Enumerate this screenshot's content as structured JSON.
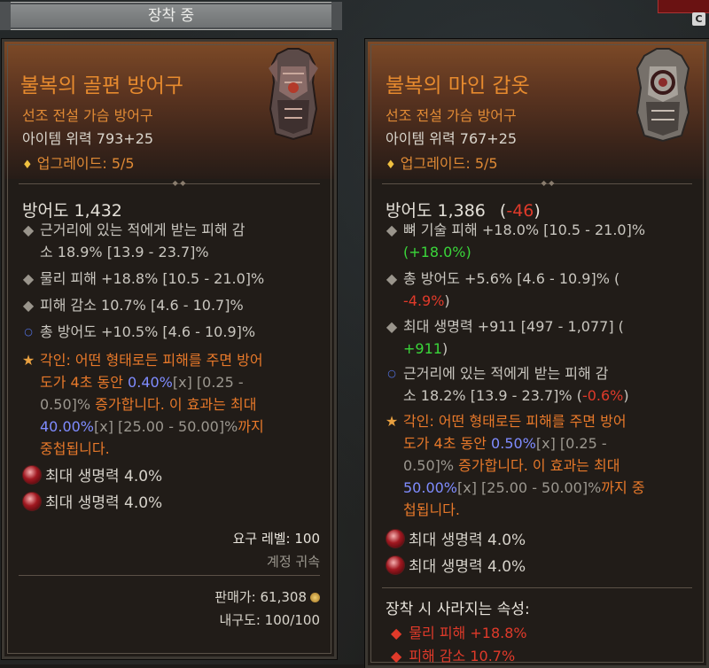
{
  "equip_tab": {
    "label": "장착 중"
  },
  "left_item": {
    "name": "불복의 골편 방어구",
    "type": "선조 전설 가슴 방어구",
    "power": "아이템 위력 793+25",
    "upgrade": "업그레이드: 5/5",
    "armor": "방어도 1,432",
    "affixes": [
      {
        "line1": "근거리에 있는 적에게 받는 피해 감",
        "line2": "소 18.9% [13.9 - 23.7]%"
      },
      {
        "text": "물리 피해 +18.8% [10.5 - 21.0]%"
      },
      {
        "text": "피해 감소 10.7% [4.6 - 10.7]%"
      },
      {
        "text": "총 방어도 +10.5% [4.6 - 10.9]%"
      }
    ],
    "aspect": {
      "l1_prefix": "각인: ",
      "l1_orange": "어떤 형태로든 피해를 주면 방어",
      "l2_orange": "도가 4초 동안 ",
      "l2_blue": "0.40%",
      "l2_gray": "[x] [0.25 -",
      "l3_gray": "0.50]%",
      "l3_orange": " 증가합니다. 이 효과는 최대",
      "l4_blue": "40.00%",
      "l4_gray": "[x] [25.00 - 50.00]%",
      "l4_orange": "까지",
      "l5_orange": "중첩됩니다."
    },
    "gems": [
      "최대 생명력 4.0%",
      "최대 생명력 4.0%"
    ],
    "required_level": "요구 레벨: 100",
    "account_bound": "계정 귀속",
    "sell_price": "판매가: 61,308",
    "durability": "내구도: 100/100"
  },
  "right_item": {
    "name": "불복의 마인 갑옷",
    "type": "선조 전설 가슴 방어구",
    "power": "아이템 위력 767+25",
    "upgrade": "업그레이드: 5/5",
    "armor": "방어도 1,386",
    "armor_open": "(",
    "armor_diff": "-46",
    "armor_close": ")",
    "affix1_line1": "뼈 기술 피해 +18.0% [10.5 - 21.0]%",
    "affix1_diff": "(+18.0%)",
    "affix2_line1": "총 방어도 +5.6% [4.6 - 10.9]% (",
    "affix2_diff": "-4.9%",
    "affix2_close": ")",
    "affix3_line1": "최대 생명력 +911 [497 - 1,077] (",
    "affix3_diff": "+911",
    "affix3_close": ")",
    "affix4_line1": "근거리에 있는 적에게 받는 피해 감",
    "affix4_line2": "소 18.2% [13.9 - 23.7]% (",
    "affix4_diff": "-0.6%",
    "affix4_close": ")",
    "aspect": {
      "l1_prefix": "각인: ",
      "l1_orange": "어떤 형태로든 피해를 주면 방어",
      "l2_orange": "도가 4초 동안 ",
      "l2_blue": "0.50%",
      "l2_gray": "[x] [0.25 -",
      "l3_gray": "0.50]%",
      "l3_orange": " 증가합니다. 이 효과는 최대",
      "l4_blue": "50.00%",
      "l4_gray": "[x] [25.00 - 50.00]%",
      "l4_orange": "까지 중",
      "l5_orange": "첩됩니다."
    },
    "gems": [
      "최대 생명력 4.0%",
      "최대 생명력 4.0%"
    ],
    "lost_title": "장착 시 사라지는 속성:",
    "lost": [
      "물리 피해 +18.8%",
      "피해 감소 10.7%"
    ]
  },
  "icons": {
    "c_key": "C"
  }
}
